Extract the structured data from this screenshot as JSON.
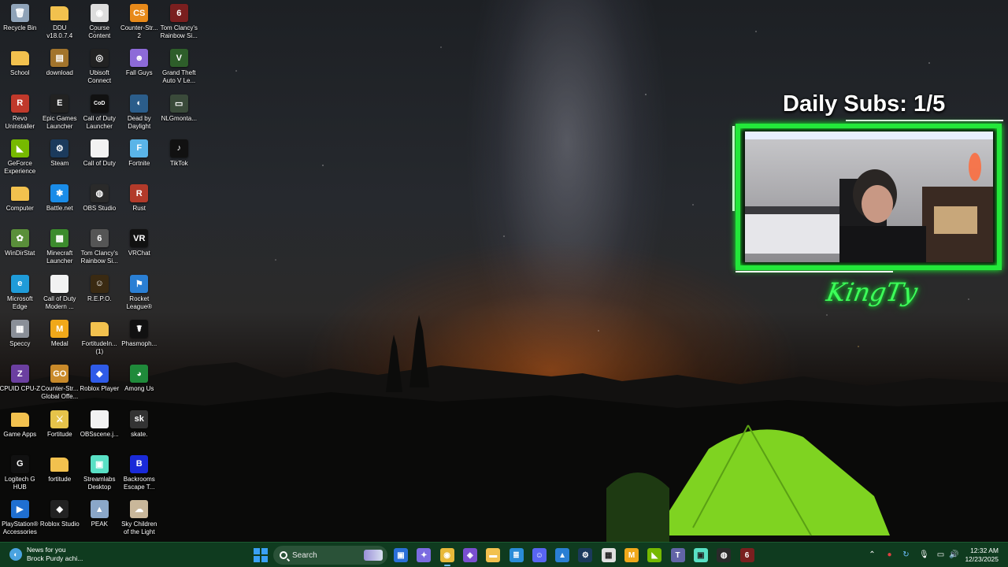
{
  "desktop": {
    "icons": [
      {
        "label": "Recycle Bin",
        "icon": "recycle-bin-icon",
        "color": "#8fa3b8",
        "glyph": "🗑"
      },
      {
        "label": "School",
        "icon": "folder-icon",
        "color": "#f2c14e",
        "glyph": ""
      },
      {
        "label": "Revo Uninstaller",
        "icon": "revo-uninstaller-icon",
        "color": "#c0392b",
        "glyph": "R"
      },
      {
        "label": "GeForce Experience",
        "icon": "geforce-icon",
        "color": "#76b900",
        "glyph": "◣"
      },
      {
        "label": "Computer",
        "icon": "folder-icon",
        "color": "#f2c14e",
        "glyph": ""
      },
      {
        "label": "WinDirStat",
        "icon": "windirstat-icon",
        "color": "#5a8f3a",
        "glyph": "✿"
      },
      {
        "label": "Microsoft Edge",
        "icon": "edge-icon",
        "color": "#1f9bd8",
        "glyph": "e"
      },
      {
        "label": "Speccy",
        "icon": "speccy-icon",
        "color": "#8a8f98",
        "glyph": "▦"
      },
      {
        "label": "CPUID CPU-Z",
        "icon": "cpuz-icon",
        "color": "#6b3fa0",
        "glyph": "Z"
      },
      {
        "label": "Game Apps",
        "icon": "folder-icon",
        "color": "#f2c14e",
        "glyph": ""
      },
      {
        "label": "Logitech G HUB",
        "icon": "logitech-icon",
        "color": "#111111",
        "glyph": "G"
      },
      {
        "label": "PlayStation® Accessories",
        "icon": "playstation-icon",
        "color": "#1f6fd1",
        "glyph": "▶"
      },
      {
        "label": "DDU v18.0.7.4",
        "icon": "folder-icon",
        "color": "#f2c14e",
        "glyph": ""
      },
      {
        "label": "download",
        "icon": "download-icon",
        "color": "#a2742c",
        "glyph": "▤"
      },
      {
        "label": "Epic Games Launcher",
        "icon": "epic-games-icon",
        "color": "#222222",
        "glyph": "E"
      },
      {
        "label": "Steam",
        "icon": "steam-icon",
        "color": "#1b3a5c",
        "glyph": "⚙"
      },
      {
        "label": "Battle.net",
        "icon": "battlenet-icon",
        "color": "#1a8ce8",
        "glyph": "✱"
      },
      {
        "label": "Minecraft Launcher",
        "icon": "minecraft-icon",
        "color": "#3c8b2d",
        "glyph": "▩"
      },
      {
        "label": "Call of Duty Modern ...",
        "icon": "document-icon",
        "color": "#f2f2f2",
        "glyph": ""
      },
      {
        "label": "Medal",
        "icon": "medal-icon",
        "color": "#f0a81a",
        "glyph": "M"
      },
      {
        "label": "Counter-Str... Global Offe...",
        "icon": "csgo-icon",
        "color": "#c98a2a",
        "glyph": "GO"
      },
      {
        "label": "Fortitude",
        "icon": "fortitude-icon",
        "color": "#e6c34a",
        "glyph": "⚔"
      },
      {
        "label": "fortitude",
        "icon": "folder-icon",
        "color": "#f2c14e",
        "glyph": ""
      },
      {
        "label": "Roblox Studio",
        "icon": "roblox-studio-icon",
        "color": "#222222",
        "glyph": "◆"
      },
      {
        "label": "Course Content",
        "icon": "chrome-icon",
        "color": "#dddddd",
        "glyph": "◉"
      },
      {
        "label": "Ubisoft Connect",
        "icon": "ubisoft-icon",
        "color": "#222222",
        "glyph": "◎"
      },
      {
        "label": "Call of Duty Launcher",
        "icon": "call-of-duty-icon",
        "color": "#111111",
        "glyph": "CoD"
      },
      {
        "label": "Call of Duty",
        "icon": "document-icon",
        "color": "#f2f2f2",
        "glyph": ""
      },
      {
        "label": "OBS Studio",
        "icon": "obs-icon",
        "color": "#2a2a2a",
        "glyph": "◍"
      },
      {
        "label": "Tom Clancy's Rainbow Si...",
        "icon": "rainbow-six-icon",
        "color": "#555555",
        "glyph": "6"
      },
      {
        "label": "R.E.P.O.",
        "icon": "repo-icon",
        "color": "#3a2a12",
        "glyph": "☺"
      },
      {
        "label": "FortitudeIn... (1)",
        "icon": "folder-icon",
        "color": "#f2c14e",
        "glyph": ""
      },
      {
        "label": "Roblox Player",
        "icon": "roblox-icon",
        "color": "#2f5be8",
        "glyph": "◆"
      },
      {
        "label": "OBSscene.j...",
        "icon": "document-icon",
        "color": "#f2f2f2",
        "glyph": ""
      },
      {
        "label": "Streamlabs Desktop",
        "icon": "streamlabs-icon",
        "color": "#59e0c5",
        "glyph": "▣"
      },
      {
        "label": "PEAK",
        "icon": "peak-icon",
        "color": "#8aa7c9",
        "glyph": "▲"
      },
      {
        "label": "Counter-Str... 2",
        "icon": "cs2-icon",
        "color": "#e88a1a",
        "glyph": "CS"
      },
      {
        "label": "Fall Guys",
        "icon": "fall-guys-icon",
        "color": "#8d6ad8",
        "glyph": "☻"
      },
      {
        "label": "Dead by Daylight",
        "icon": "dead-by-daylight-icon",
        "color": "#2b5d8a",
        "glyph": "◐"
      },
      {
        "label": "Fortnite",
        "icon": "fortnite-icon",
        "color": "#5ab4e8",
        "glyph": "F"
      },
      {
        "label": "Rust",
        "icon": "rust-icon",
        "color": "#b23a2a",
        "glyph": "R"
      },
      {
        "label": "VRChat",
        "icon": "vrchat-icon",
        "color": "#111111",
        "glyph": "VR"
      },
      {
        "label": "Rocket League®",
        "icon": "rocket-league-icon",
        "color": "#2a7fd4",
        "glyph": "⚑"
      },
      {
        "label": "Phasmoph...",
        "icon": "phasmophobia-icon",
        "color": "#111111",
        "glyph": "☤"
      },
      {
        "label": "Among Us",
        "icon": "among-us-icon",
        "color": "#1f8a3a",
        "glyph": "◕"
      },
      {
        "label": "skate.",
        "icon": "skate-icon",
        "color": "#333333",
        "glyph": "sk"
      },
      {
        "label": "Backrooms Escape T...",
        "icon": "backrooms-icon",
        "color": "#1a2ad8",
        "glyph": "B"
      },
      {
        "label": "Sky Children of the Light",
        "icon": "sky-icon",
        "color": "#c9b79a",
        "glyph": "☁"
      },
      {
        "label": "Tom Clancy's Rainbow Si...",
        "icon": "rainbow-six-icon",
        "color": "#7a1f1f",
        "glyph": "6"
      },
      {
        "label": "Grand Theft Auto V Le...",
        "icon": "gta-icon",
        "color": "#2e5e2a",
        "glyph": "V"
      },
      {
        "label": "NLGmonta...",
        "icon": "nvidia-video-icon",
        "color": "#3a4a3a",
        "glyph": "▭"
      },
      {
        "label": "TikTok",
        "icon": "tiktok-icon",
        "color": "#111111",
        "glyph": "♪"
      }
    ]
  },
  "overlay": {
    "daily_subs": "Daily Subs: 1/5",
    "signature": "KingTy"
  },
  "taskbar": {
    "news_title": "News for you",
    "news_subtitle": "Brock Purdy achi...",
    "search_label": "Search",
    "apps": [
      {
        "name": "taskbar-file-icon",
        "color": "#2b6fd8",
        "glyph": "▣"
      },
      {
        "name": "taskbar-copilot-icon",
        "color": "#7b6be0",
        "glyph": "✦"
      },
      {
        "name": "taskbar-chrome-icon",
        "color": "#e8b93a",
        "glyph": "◉"
      },
      {
        "name": "taskbar-app-icon",
        "color": "#7a4fd0",
        "glyph": "◈"
      },
      {
        "name": "taskbar-file-explorer-icon",
        "color": "#f2c14e",
        "glyph": "▬"
      },
      {
        "name": "taskbar-notepad-icon",
        "color": "#2a8cd8",
        "glyph": "≣"
      },
      {
        "name": "taskbar-discord-icon",
        "color": "#5865f2",
        "glyph": "☺"
      },
      {
        "name": "taskbar-photos-icon",
        "color": "#2a7fd4",
        "glyph": "▲"
      },
      {
        "name": "taskbar-steam-icon",
        "color": "#1b3a5c",
        "glyph": "⚙"
      },
      {
        "name": "taskbar-store-icon",
        "color": "#e0e0e0",
        "glyph": "▦"
      },
      {
        "name": "taskbar-medal-icon",
        "color": "#f0a81a",
        "glyph": "M"
      },
      {
        "name": "taskbar-gpu-icon",
        "color": "#76b900",
        "glyph": "◣"
      },
      {
        "name": "taskbar-teams-icon",
        "color": "#6264a7",
        "glyph": "T"
      },
      {
        "name": "taskbar-streamlabs-icon",
        "color": "#59e0c5",
        "glyph": "▣"
      },
      {
        "name": "taskbar-obs-icon",
        "color": "#2a2a2a",
        "glyph": "◍"
      },
      {
        "name": "taskbar-rainbow-six-icon",
        "color": "#7a1f1f",
        "glyph": "6"
      }
    ],
    "time": "12:32 AM",
    "date": "12/23/2025"
  }
}
